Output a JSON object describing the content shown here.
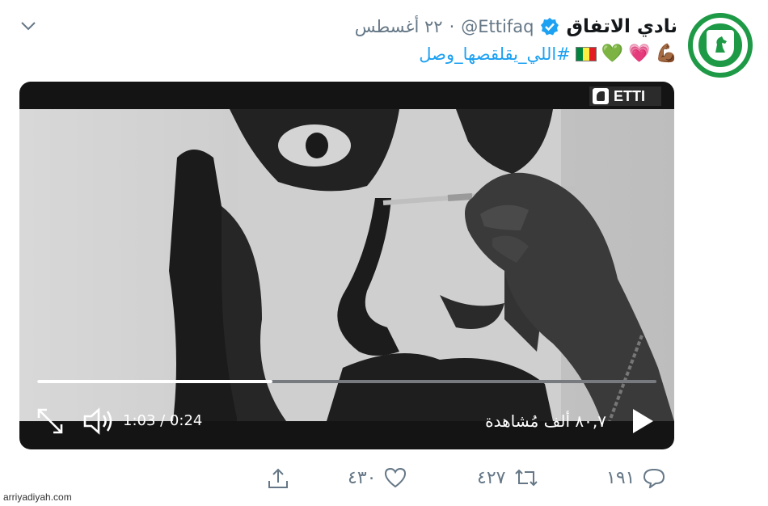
{
  "tweet": {
    "display_name": "نادي الاتفاق",
    "handle": "@Ettifaq",
    "separator": "·",
    "date": "٢٢ أغسطس",
    "hashtag": "#اللي_يقلقصها_وصل",
    "emojis": [
      "💪🏾",
      "💗",
      "💚"
    ],
    "avatar_label": "ETTIFAQ F.C."
  },
  "video": {
    "watermark": "ETTI",
    "time": "1:03 / 0:24",
    "views": "٨٠,٧ ألف مُشاهدة",
    "progress": 0.38
  },
  "actions": {
    "reply_count": "١٩١",
    "retweet_count": "٤٢٧",
    "like_count": "٤٣٠"
  },
  "source": "arriyadiyah.com",
  "colors": {
    "accent": "#1da1f2",
    "muted": "#657786",
    "club_green": "#1e9a46"
  }
}
